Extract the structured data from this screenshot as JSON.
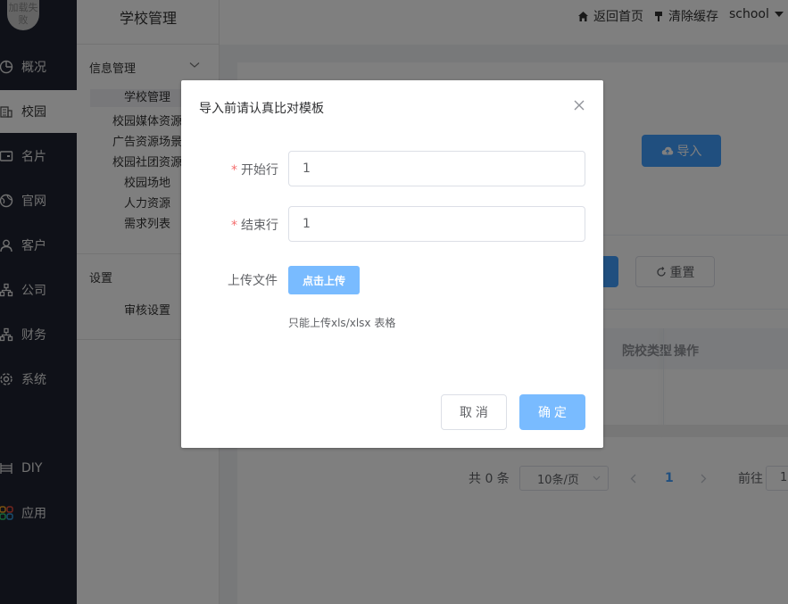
{
  "nav": {
    "avatar_text": "加载失败",
    "items": [
      {
        "label": "概况",
        "icon": "pie-chart-icon"
      },
      {
        "label": "校园",
        "icon": "building-icon"
      },
      {
        "label": "名片",
        "icon": "card-icon"
      },
      {
        "label": "官网",
        "icon": "globe-icon"
      },
      {
        "label": "客户",
        "icon": "user-icon"
      },
      {
        "label": "公司",
        "icon": "org-chart-icon"
      },
      {
        "label": "财务",
        "icon": "org-chart-icon"
      },
      {
        "label": "系统",
        "icon": "gear-icon"
      },
      {
        "label": "DIY",
        "icon": "diy-icon"
      },
      {
        "label": "应用",
        "icon": "apps-grid-icon"
      }
    ],
    "active_index": 1
  },
  "sub_sidebar": {
    "title": "学校管理",
    "group1": "信息管理",
    "links": [
      "学校管理",
      "校园媒体资源",
      "广告资源场景",
      "校园社团资源",
      "校园场地",
      "人力资源",
      "需求列表"
    ],
    "group2": "设置",
    "links2": [
      "审核设置"
    ]
  },
  "topbar": {
    "home": "返回首页",
    "clear_cache": "清除缓存",
    "user": "school"
  },
  "content": {
    "import_label": "导入",
    "reset_label": "重置",
    "columns": [
      "院校类型",
      "操作"
    ],
    "pager": {
      "total": "共 0 条",
      "page_size": "10条/页",
      "current_page": "1",
      "goto_label": "前往",
      "goto_value": "1"
    }
  },
  "dialog": {
    "title": "导入前请认真比对模板",
    "start_row_label": "开始行",
    "start_row_value": "1",
    "end_row_label": "结束行",
    "end_row_value": "1",
    "upload_label": "上传文件",
    "upload_button": "点击上传",
    "upload_tip": "只能上传xls/xlsx 表格",
    "cancel": "取 消",
    "confirm": "确 定"
  },
  "colors": {
    "primary": "#409eff",
    "primary_light": "#79bbff",
    "sidebar_dark": "#1e2330",
    "required": "#f56c6c"
  }
}
